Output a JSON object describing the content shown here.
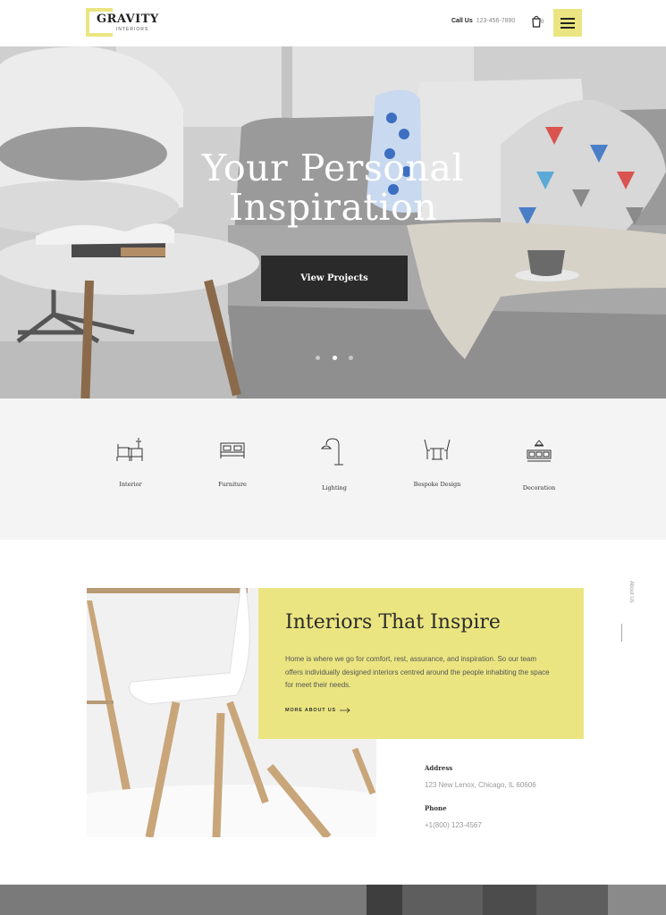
{
  "header": {
    "logo": {
      "name": "GRAVITY",
      "sub": "INTERIORS"
    },
    "call_label": "Call Us",
    "phone": "123-456-7890",
    "cart_count": "0",
    "menu_icon": "hamburger-icon"
  },
  "hero": {
    "title_line1": "Your Personal",
    "title_line2": "Inspiration",
    "button_label": "View Projects",
    "slides": 3,
    "active_slide": 2
  },
  "services": [
    {
      "label": "Interior",
      "icon": "desk-chair-icon"
    },
    {
      "label": "Furniture",
      "icon": "bed-icon"
    },
    {
      "label": "Lighting",
      "icon": "floor-lamp-icon"
    },
    {
      "label": "Bespoke Design",
      "icon": "table-chairs-icon"
    },
    {
      "label": "Decoration",
      "icon": "wall-frames-icon"
    }
  ],
  "about": {
    "title": "Interiors That Inspire",
    "text": "Home is where we go for comfort, rest, assurance, and inspiration. So our team offers individually designed interiors centred around the people inhabiting the space for meet their needs.",
    "more_label": "MORE ABOUT US",
    "side_label": "About Us",
    "address_label": "Address",
    "address": "123 New Lenox, Chicago, IL 60606",
    "phone_label": "Phone",
    "phone": "+1(800) 123-4567"
  },
  "colors": {
    "accent": "#ebe581",
    "dark": "#2a2a2a",
    "light_bg": "#f4f4f4"
  }
}
